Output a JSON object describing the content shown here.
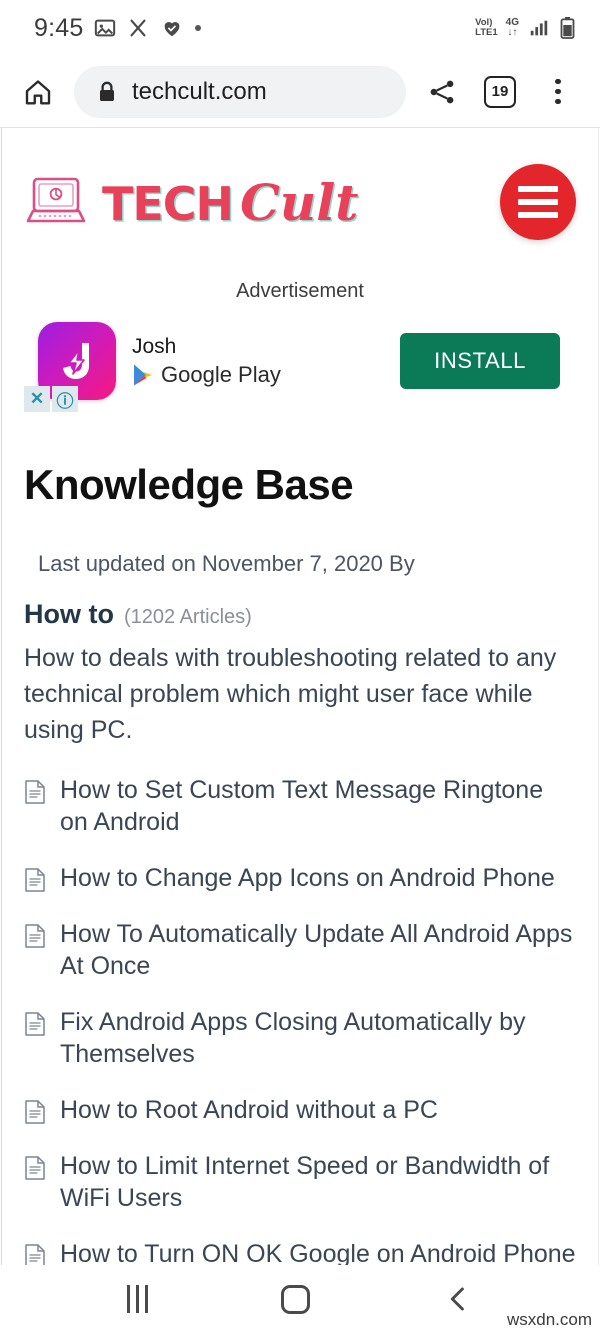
{
  "status_bar": {
    "time": "9:45",
    "icons_left": [
      "image-icon",
      "scissors-icon",
      "heart-check-icon",
      "dot-icon"
    ],
    "volte_line1": "Vol)",
    "volte_line2": "LTE1",
    "network_type": "4G",
    "network_arrows": "↓↑",
    "icons_right": [
      "signal-bars-icon",
      "battery-icon"
    ]
  },
  "browser": {
    "home_icon": "home-icon",
    "lock_icon": "lock-icon",
    "url": "techcult.com",
    "share_icon": "share-icon",
    "tab_count": "19",
    "menu_icon": "kebab-menu-icon"
  },
  "site": {
    "logo_icon": "laptop-logo-icon",
    "brand_part1": "TECH",
    "brand_part2": "Cult",
    "menu_button_icon": "hamburger-menu-icon"
  },
  "ad": {
    "label": "Advertisement",
    "app_name": "Josh",
    "store": "Google Play",
    "store_icon": "google-play-icon",
    "app_icon": "josh-app-icon",
    "close_icon": "✕",
    "info_icon": "ⓘ",
    "install_label": "INSTALL"
  },
  "article": {
    "title": "Knowledge Base",
    "meta": "Last updated on November 7, 2020 By",
    "category_name": "How to",
    "category_count": "(1202 Articles)",
    "category_description": "How to deals with troubleshooting related to any technical problem which might user face while using PC.",
    "items": [
      {
        "icon": "document-icon",
        "label": "How to Set Custom Text Message Ringtone on Android"
      },
      {
        "icon": "document-icon",
        "label": "How to Change App Icons on Android Phone"
      },
      {
        "icon": "document-icon",
        "label": "How To Automatically Update All Android Apps At Once"
      },
      {
        "icon": "document-icon",
        "label": "Fix Android Apps Closing Automatically by Themselves"
      },
      {
        "icon": "document-icon",
        "label": "How to Root Android without a PC"
      },
      {
        "icon": "document-icon",
        "label": "How to Limit Internet Speed or Bandwidth of WiFi Users"
      },
      {
        "icon": "document-icon",
        "label": "How to Turn ON OK Google on Android Phone"
      }
    ]
  },
  "nav_bar": {
    "recents_icon": "recents-icon",
    "home_icon": "home-square-icon",
    "back_icon": "back-chevron-icon"
  },
  "watermark": "wsxdn.com",
  "colors": {
    "brand_red": "#e8415a",
    "menu_red": "#e3262b",
    "install_green": "#0b7a56",
    "text_dark": "#3a4654",
    "urlbar_bg": "#f1f2f4"
  }
}
